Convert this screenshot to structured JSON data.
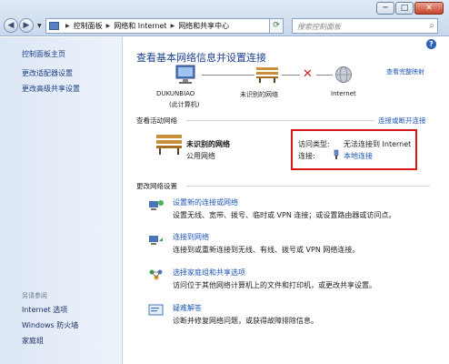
{
  "window": {
    "controls": {
      "minimize": "─",
      "maximize": "□",
      "close": "✕"
    }
  },
  "address_bar": {
    "crumbs": [
      "控制面板",
      "网络和 Internet",
      "网络和共享中心"
    ],
    "back_icon": "back-arrow-icon",
    "forward_icon": "forward-arrow-icon"
  },
  "search": {
    "placeholder": "搜索控制面板"
  },
  "sidebar": {
    "items": [
      {
        "label": "控制面板主页"
      },
      {
        "label": "更改适配器设置"
      },
      {
        "label": "更改高级共享设置"
      }
    ],
    "see_also_heading": "另请参阅",
    "see_also": [
      {
        "label": "Internet 选项"
      },
      {
        "label": "Windows 防火墙"
      },
      {
        "label": "家庭组"
      }
    ]
  },
  "main": {
    "title": "查看基本网络信息并设置连接",
    "full_map_link": "查看完整映射",
    "map": {
      "computer_name": "DUKUNBIAO",
      "computer_sub": "(此计算机)",
      "network_label": "未识别的网络",
      "internet_label": "Internet"
    },
    "active_networks_label": "查看活动网络",
    "connect_link": "连接或断开连接",
    "network": {
      "name": "未识别的网络",
      "type": "公用网络",
      "access_type_key": "访问类型:",
      "access_type_value": "无法连接到 Internet",
      "connections_key": "连接:",
      "connections_value": "本地连接"
    },
    "change_settings_label": "更改网络设置",
    "tasks": [
      {
        "title": "设置新的连接或网络",
        "desc": "设置无线、宽带、拨号、临时或 VPN 连接；或设置路由器或访问点。"
      },
      {
        "title": "连接到网络",
        "desc": "连接到或重新连接到无线、有线、拨号或 VPN 网络连接。"
      },
      {
        "title": "选择家庭组和共享选项",
        "desc": "访问位于其他网络计算机上的文件和打印机，或更改共享设置。"
      },
      {
        "title": "疑难解答",
        "desc": "诊断并修复网络问题，或获得故障排除信息。"
      }
    ]
  },
  "colors": {
    "link": "#1e56b8",
    "title": "#1b3f8f",
    "highlight_box": "#d81818"
  }
}
